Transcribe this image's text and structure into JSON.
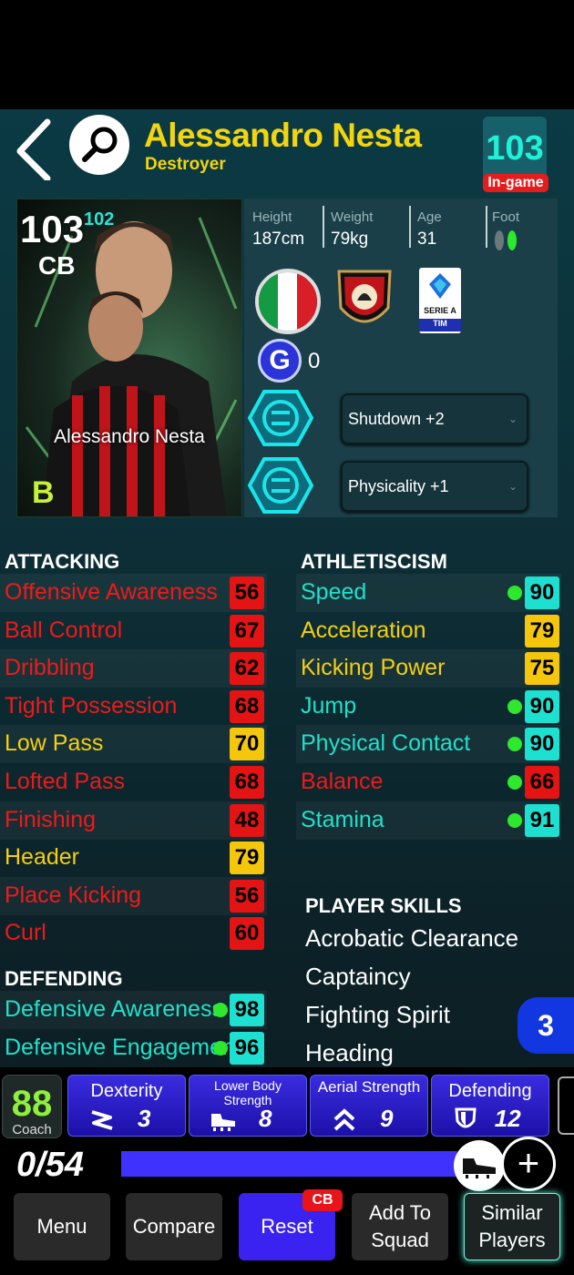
{
  "header": {
    "player_name": "Alessandro Nesta",
    "playing_style": "Destroyer",
    "overall": "103",
    "overall_tag": "In-game"
  },
  "card": {
    "rating": "103",
    "boost": "102",
    "position": "CB",
    "name": "Alessandro Nesta",
    "grade": "B"
  },
  "info": {
    "height_label": "Height",
    "height_value": "187cm",
    "weight_label": "Weight",
    "weight_value": "79kg",
    "age_label": "Age",
    "age_value": "31",
    "foot_label": "Foot",
    "league_text": "SERIE A",
    "league_sponsor": "TIM",
    "g_count": "0",
    "booster1": "Shutdown +2",
    "booster2": "Physicality +1"
  },
  "attacking": {
    "title": "ATTACKING",
    "stats": [
      {
        "name": "Offensive Awareness",
        "value": "56",
        "color": "red"
      },
      {
        "name": "Ball Control",
        "value": "67",
        "color": "red"
      },
      {
        "name": "Dribbling",
        "value": "62",
        "color": "red"
      },
      {
        "name": "Tight Possession",
        "value": "68",
        "color": "red"
      },
      {
        "name": "Low Pass",
        "value": "70",
        "color": "yellow"
      },
      {
        "name": "Lofted Pass",
        "value": "68",
        "color": "red"
      },
      {
        "name": "Finishing",
        "value": "48",
        "color": "red"
      },
      {
        "name": "Header",
        "value": "79",
        "color": "yellow"
      },
      {
        "name": "Place Kicking",
        "value": "56",
        "color": "red"
      },
      {
        "name": "Curl",
        "value": "60",
        "color": "red"
      }
    ]
  },
  "defending": {
    "title": "DEFENDING",
    "stats": [
      {
        "name": "Defensive Awareness",
        "value": "98",
        "color": "cyan"
      },
      {
        "name": "Defensive Engagement",
        "value": "96",
        "color": "cyan"
      }
    ]
  },
  "athleticism": {
    "title": "ATHLETISCISM",
    "stats": [
      {
        "name": "Speed",
        "value": "90",
        "color": "cyan"
      },
      {
        "name": "Acceleration",
        "value": "79",
        "color": "yellow"
      },
      {
        "name": "Kicking Power",
        "value": "75",
        "color": "yellow"
      },
      {
        "name": "Jump",
        "value": "90",
        "color": "cyan"
      },
      {
        "name": "Physical Contact",
        "value": "90",
        "color": "cyan"
      },
      {
        "name": "Balance",
        "value": "66",
        "color": "red"
      },
      {
        "name": "Stamina",
        "value": "91",
        "color": "cyan"
      }
    ]
  },
  "skills": {
    "title": "PLAYER SKILLS",
    "items": [
      "Acrobatic Clearance",
      "Captaincy",
      "Fighting Spirit",
      "Heading"
    ],
    "count_badge": "3"
  },
  "training": {
    "coach_value": "88",
    "coach_label": "Coach",
    "items": [
      {
        "label": "Dexterity",
        "value": "3",
        "icon": "dexterity-icon"
      },
      {
        "label": "Lower Body Strength",
        "value": "8",
        "icon": "boot-icon"
      },
      {
        "label": "Aerial Strength",
        "value": "9",
        "icon": "double-chevron-up-icon"
      },
      {
        "label": "Defending",
        "value": "12",
        "icon": "shield-icon"
      }
    ]
  },
  "progress": {
    "text": "0/54",
    "fraction": 0.92
  },
  "nav": {
    "menu": "Menu",
    "compare": "Compare",
    "reset": "Reset",
    "reset_tag": "CB",
    "add_to_squad": "Add To Squad",
    "similar_players": "Similar Players"
  },
  "colors": {
    "accent": "#f3d50e",
    "cyan": "#20e0cc",
    "red": "#e41414",
    "yellow": "#f4c60c",
    "blue": "#3a22f0"
  }
}
